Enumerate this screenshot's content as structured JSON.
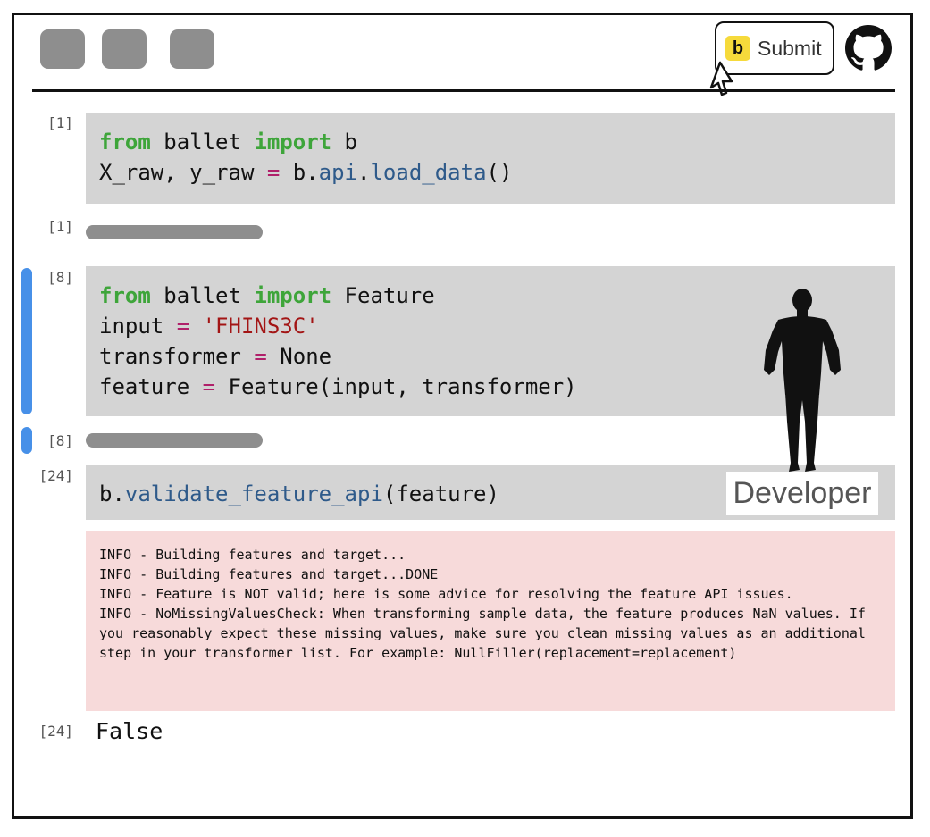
{
  "toolbar": {
    "submit_badge": "b",
    "submit_label": "Submit"
  },
  "cells": [
    {
      "prompt": "[1]",
      "kind": "input"
    },
    {
      "prompt": "[1]",
      "kind": "output-collapsed"
    },
    {
      "prompt": "[8]",
      "kind": "input"
    },
    {
      "prompt": "[8]",
      "kind": "output-collapsed"
    },
    {
      "prompt": "[24]",
      "kind": "input"
    },
    {
      "prompt": "[24]",
      "kind": "output",
      "text": "False"
    }
  ],
  "code": {
    "cell1": {
      "t_from": "from",
      "t_ballet": " ballet ",
      "t_import": "import",
      "t_b": " b",
      "t_xy": "X_raw, y_raw ",
      "t_eq": "=",
      "t_bdot": " b.",
      "t_api": "api",
      "t_dot": ".",
      "t_load": "load_data",
      "t_paren": "()"
    },
    "cell2": {
      "t_from": "from",
      "t_ballet": " ballet ",
      "t_import": "import",
      "t_feature": " Feature",
      "t_input": "input ",
      "t_eq1": "=",
      "t_str": " 'FHINS3C'",
      "t_transformer": "transformer ",
      "t_eq2": "=",
      "t_none": " None",
      "t_featvar": "feature ",
      "t_eq3": "=",
      "t_call": " Feature(input, transformer)"
    },
    "cell3": {
      "t_b": "b.",
      "t_fn": "validate_feature_api",
      "t_arg": "(feature)"
    }
  },
  "stderr_lines": [
    "INFO - Building features and target...",
    "INFO - Building features and target...DONE",
    "INFO - Feature is NOT valid; here is some advice for resolving the feature API issues.",
    "INFO - NoMissingValuesCheck: When transforming sample data, the feature produces NaN values. If you reasonably expect these missing values, make sure you clean missing values as an additional step in your transformer list. For example: NullFiller(replacement=replacement)"
  ],
  "overlay": {
    "developer_label": "Developer"
  },
  "colors": {
    "keyword": "#3ea53a",
    "operator": "#b0206a",
    "function": "#2e5a8a",
    "string": "#a31515",
    "cell_bg": "#d4d4d4",
    "stderr_bg": "#f7dada",
    "active_indicator": "#4790e8",
    "submit_badge": "#f6da3b"
  }
}
